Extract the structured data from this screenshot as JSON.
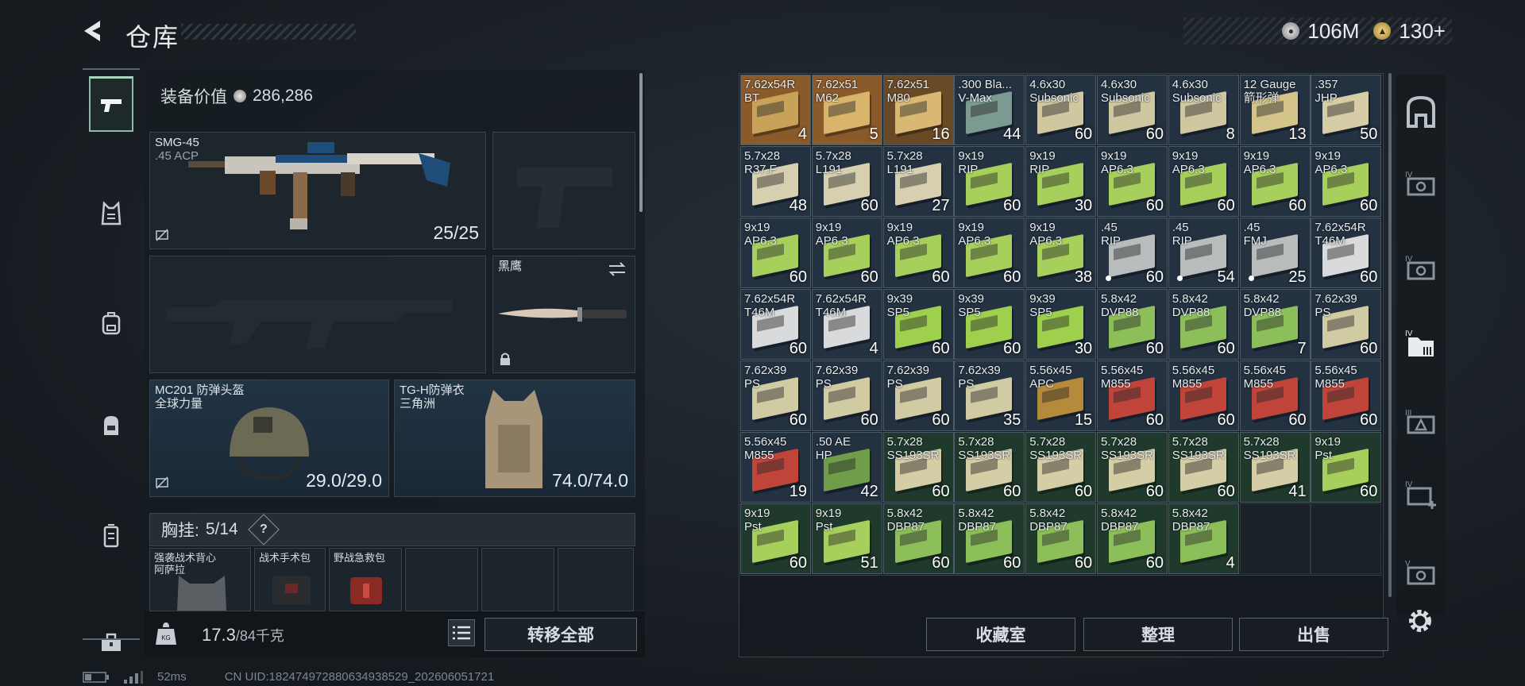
{
  "header": {
    "title": "仓库"
  },
  "currency": [
    {
      "name": "silver-coin-icon",
      "value": "106M",
      "color": "#c9c9c9"
    },
    {
      "name": "gold-coin-icon",
      "value": "130+",
      "color": "#d1a84a"
    }
  ],
  "left_nav": {
    "items": [
      "pistol-icon",
      "vest-icon",
      "backpack-icon",
      "bag-icon",
      "locker-icon",
      "toolbox-icon"
    ],
    "active": 0
  },
  "loadout": {
    "value_label": "装备价值",
    "value": "286,286",
    "primary": {
      "name": "SMG-45",
      "caliber": ".45 ACP",
      "ammo": "25/25"
    },
    "melee": {
      "name": "黑鹰"
    },
    "helmet": {
      "name": "MC201 防弹头盔",
      "sub": "全球力量",
      "durability": "29.0/29.0"
    },
    "armor": {
      "name": "TG-H防弹衣",
      "sub": "三角洲",
      "durability": "74.0/74.0"
    },
    "vest": {
      "label": "胸挂:",
      "count": "5/14",
      "help": "?"
    },
    "vest_items": [
      {
        "name": "强袭战术背心",
        "sub": "阿萨拉"
      },
      {
        "name": "战术手术包",
        "sub": ""
      },
      {
        "name": "野战急救包",
        "sub": ""
      },
      {
        "name": "",
        "sub": ""
      },
      {
        "name": "",
        "sub": ""
      },
      {
        "name": "",
        "sub": ""
      }
    ]
  },
  "weight": {
    "current": "17.3",
    "max": "/84千克"
  },
  "transfer_all": "转移全部",
  "status": {
    "ping": "52ms",
    "uid": "CN UID:182474972880634938529_202606051721"
  },
  "inventory": [
    {
      "cal": "7.62x54R\nBT",
      "count": "4",
      "color": "#8a5a2a",
      "box": "#c9a25a"
    },
    {
      "cal": "7.62x51\nM62",
      "count": "5",
      "color": "#8a5a2a",
      "box": "#d8b56a"
    },
    {
      "cal": "7.62x51\nM80",
      "count": "16",
      "color": "#6a4a26",
      "box": "#d9b873"
    },
    {
      "cal": ".300 Bla...\nV-Max",
      "count": "44",
      "color": "#233140",
      "box": "#7a9a92"
    },
    {
      "cal": "4.6x30\nSubsonic",
      "count": "60",
      "color": "#233140",
      "box": "#cfc7a0"
    },
    {
      "cal": "4.6x30\nSubsonic",
      "count": "60",
      "color": "#233140",
      "box": "#cfc7a0"
    },
    {
      "cal": "4.6x30\nSubsonic",
      "count": "8",
      "color": "#233140",
      "box": "#cfc7a0"
    },
    {
      "cal": "12 Gauge\n箭形弹",
      "count": "13",
      "color": "#233140",
      "box": "#d4c48a"
    },
    {
      "cal": ".357\nJHP",
      "count": "50",
      "color": "#233140",
      "box": "#d6cda8"
    },
    {
      "cal": "5.7x28\nR37.F",
      "count": "48",
      "color": "#233140",
      "box": "#d6cfb0"
    },
    {
      "cal": "5.7x28\nL191",
      "count": "60",
      "color": "#233140",
      "box": "#d6cfb0"
    },
    {
      "cal": "5.7x28\nL191",
      "count": "27",
      "color": "#233140",
      "box": "#d6cfb0"
    },
    {
      "cal": "9x19\nRIP",
      "count": "60",
      "color": "#233140",
      "box": "#a6cf5c"
    },
    {
      "cal": "9x19\nRIP",
      "count": "30",
      "color": "#233140",
      "box": "#a6cf5c"
    },
    {
      "cal": "9x19\nAP6.3",
      "count": "60",
      "color": "#233140",
      "box": "#a6cf5c"
    },
    {
      "cal": "9x19\nAP6.3",
      "count": "60",
      "color": "#233140",
      "box": "#a6cf5c"
    },
    {
      "cal": "9x19\nAP6.3",
      "count": "60",
      "color": "#233140",
      "box": "#a6cf5c"
    },
    {
      "cal": "9x19\nAP6.3",
      "count": "60",
      "color": "#233140",
      "box": "#a6cf5c"
    },
    {
      "cal": "9x19\nAP6.3",
      "count": "60",
      "color": "#233140",
      "box": "#a6cf5c"
    },
    {
      "cal": "9x19\nAP6.3",
      "count": "60",
      "color": "#233140",
      "box": "#a6cf5c"
    },
    {
      "cal": "9x19\nAP6.3",
      "count": "60",
      "color": "#233140",
      "box": "#a6cf5c"
    },
    {
      "cal": "9x19\nAP6.3",
      "count": "60",
      "color": "#233140",
      "box": "#a6cf5c"
    },
    {
      "cal": "9x19\nAP6.3",
      "count": "38",
      "color": "#233140",
      "box": "#a6cf5c"
    },
    {
      "cal": ".45\nRIP",
      "count": "60",
      "color": "#233140",
      "box": "#b9bcbd",
      "dot": true
    },
    {
      "cal": ".45\nRIP",
      "count": "54",
      "color": "#233140",
      "box": "#b9bcbd",
      "dot": true
    },
    {
      "cal": ".45\nFMJ",
      "count": "25",
      "color": "#233140",
      "box": "#b9bcbd",
      "dot": true
    },
    {
      "cal": "7.62x54R\nT46M",
      "count": "60",
      "color": "#233140",
      "box": "#d8dadb"
    },
    {
      "cal": "7.62x54R\nT46M",
      "count": "60",
      "color": "#233140",
      "box": "#d8dadb"
    },
    {
      "cal": "7.62x54R\nT46M",
      "count": "4",
      "color": "#233140",
      "box": "#d8dadb"
    },
    {
      "cal": "9x39\nSP5",
      "count": "60",
      "color": "#233140",
      "box": "#9ed04e"
    },
    {
      "cal": "9x39\nSP5",
      "count": "60",
      "color": "#233140",
      "box": "#9ed04e"
    },
    {
      "cal": "9x39\nSP5",
      "count": "30",
      "color": "#233140",
      "box": "#9ed04e"
    },
    {
      "cal": "5.8x42\nDVP88",
      "count": "60",
      "color": "#233140",
      "box": "#8cbf5a"
    },
    {
      "cal": "5.8x42\nDVP88",
      "count": "60",
      "color": "#233140",
      "box": "#8cbf5a"
    },
    {
      "cal": "5.8x42\nDVP88",
      "count": "7",
      "color": "#233140",
      "box": "#8cbf5a"
    },
    {
      "cal": "7.62x39\nPS",
      "count": "60",
      "color": "#233140",
      "box": "#d1cba4"
    },
    {
      "cal": "7.62x39\nPS",
      "count": "60",
      "color": "#233140",
      "box": "#d1cba4"
    },
    {
      "cal": "7.62x39\nPS",
      "count": "60",
      "color": "#233140",
      "box": "#d1cba4"
    },
    {
      "cal": "7.62x39\nPS",
      "count": "60",
      "color": "#233140",
      "box": "#d1cba4"
    },
    {
      "cal": "7.62x39\nPS",
      "count": "35",
      "color": "#233140",
      "box": "#d1cba4"
    },
    {
      "cal": "5.56x45\nAPC",
      "count": "15",
      "color": "#233140",
      "box": "#b58a3a"
    },
    {
      "cal": "5.56x45\nM855",
      "count": "60",
      "color": "#233140",
      "box": "#c0443a"
    },
    {
      "cal": "5.56x45\nM855",
      "count": "60",
      "color": "#233140",
      "box": "#c0443a"
    },
    {
      "cal": "5.56x45\nM855",
      "count": "60",
      "color": "#233140",
      "box": "#c0443a"
    },
    {
      "cal": "5.56x45\nM855",
      "count": "60",
      "color": "#233140",
      "box": "#c0443a"
    },
    {
      "cal": "5.56x45\nM855",
      "count": "19",
      "color": "#233140",
      "box": "#c0443a"
    },
    {
      "cal": ".50 AE\nHP",
      "count": "42",
      "color": "#233140",
      "box": "#6f9d4a"
    },
    {
      "cal": "5.7x28\nSS193SR",
      "count": "60",
      "color": "#1f3a2c",
      "box": "#d5cda5"
    },
    {
      "cal": "5.7x28\nSS193SR",
      "count": "60",
      "color": "#1f3a2c",
      "box": "#d5cda5"
    },
    {
      "cal": "5.7x28\nSS193SR",
      "count": "60",
      "color": "#1f3a2c",
      "box": "#d5cda5"
    },
    {
      "cal": "5.7x28\nSS193SR",
      "count": "60",
      "color": "#1f3a2c",
      "box": "#d5cda5"
    },
    {
      "cal": "5.7x28\nSS193SR",
      "count": "60",
      "color": "#1f3a2c",
      "box": "#d5cda5"
    },
    {
      "cal": "5.7x28\nSS193SR",
      "count": "41",
      "color": "#1f3a2c",
      "box": "#d5cda5"
    },
    {
      "cal": "9x19\nPst",
      "count": "60",
      "color": "#1f3a2c",
      "box": "#a6cf5c"
    },
    {
      "cal": "9x19\nPst",
      "count": "60",
      "color": "#1f3a2c",
      "box": "#a6cf5c"
    },
    {
      "cal": "9x19\nPst",
      "count": "51",
      "color": "#1f3a2c",
      "box": "#a6cf5c"
    },
    {
      "cal": "5.8x42\nDBP87",
      "count": "60",
      "color": "#1f3a2c",
      "box": "#8cbf5a"
    },
    {
      "cal": "5.8x42\nDBP87",
      "count": "60",
      "color": "#1f3a2c",
      "box": "#8cbf5a"
    },
    {
      "cal": "5.8x42\nDBP87",
      "count": "60",
      "color": "#1f3a2c",
      "box": "#8cbf5a"
    },
    {
      "cal": "5.8x42\nDBP87",
      "count": "60",
      "color": "#1f3a2c",
      "box": "#8cbf5a"
    },
    {
      "cal": "5.8x42\nDBP87",
      "count": "4",
      "color": "#1f3a2c",
      "box": "#8cbf5a"
    }
  ],
  "actions": {
    "collection": "收藏室",
    "sort": "整理",
    "sell": "出售"
  },
  "right_nav": [
    "safe-icon",
    "case-iv-icon",
    "case-iv-icon",
    "case-iv-folder-icon",
    "case-iii-icon",
    "case-iv-plus-icon",
    "case-v-icon"
  ],
  "colors": {
    "accent": "#8fb9a8",
    "panel": "#1e262d",
    "border": "#4d5b67"
  }
}
